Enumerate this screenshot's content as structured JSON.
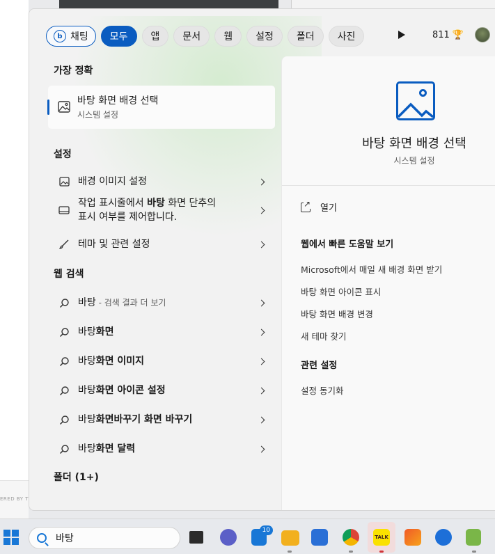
{
  "filters": {
    "chat_label": "채팅",
    "items": [
      "모두",
      "앱",
      "문서",
      "웹",
      "설정",
      "폴더",
      "사진"
    ],
    "active_index": 0
  },
  "header": {
    "points": "811",
    "trophy_glyph": "🏆"
  },
  "left": {
    "best_match_title": "가장 정확",
    "best_match": {
      "title": "바탕 화면 배경 선택",
      "subtitle": "시스템 설정"
    },
    "settings_title": "설정",
    "settings": [
      {
        "label": "배경 이미지 설정"
      },
      {
        "label_pre": "작업 표시줄에서 ",
        "label_bold": "바탕",
        "label_post": " 화면 단추의",
        "label_line2": "표시 여부를 제어합니다."
      },
      {
        "label": "테마 및 관련 설정"
      }
    ],
    "web_title": "웹 검색",
    "web": [
      {
        "query": "바탕",
        "suffix": " - 검색 결과 더 보기"
      },
      {
        "query_pre": "바탕",
        "query_bold": "화면"
      },
      {
        "query_pre": "바탕",
        "query_bold": "화면 이미지"
      },
      {
        "query_pre": "바탕",
        "query_bold": "화면 아이콘 설정"
      },
      {
        "query_pre": "바탕",
        "query_bold": "화면바꾸기 화면 바꾸기"
      },
      {
        "query_pre": "바탕",
        "query_bold": "화면 달력"
      }
    ],
    "folders_title": "폴더 (1+)"
  },
  "preview": {
    "title": "바탕 화면 배경 선택",
    "subtitle": "시스템 설정",
    "open_label": "열기",
    "web_help_title": "웹에서 빠른 도움말 보기",
    "web_help_links": [
      "Microsoft에서 매일 새 배경 화면 받기",
      "바탕 화면 아이콘 표시",
      "바탕 화면 배경 변경",
      "새 테마 찾기"
    ],
    "related_title": "관련 설정",
    "related_links": [
      "설정 동기화"
    ]
  },
  "taskbar": {
    "search_value": "바탕",
    "mail_badge": "10",
    "kakao_label": "TALK"
  },
  "background": {
    "left_fragment": "ERED BY TI"
  },
  "colors": {
    "accent": "#0a5cc0",
    "panel_bg": "#f2f2f2",
    "preview_bg": "#f9f9f9",
    "taskbar_bg": "#e7e9ed"
  }
}
